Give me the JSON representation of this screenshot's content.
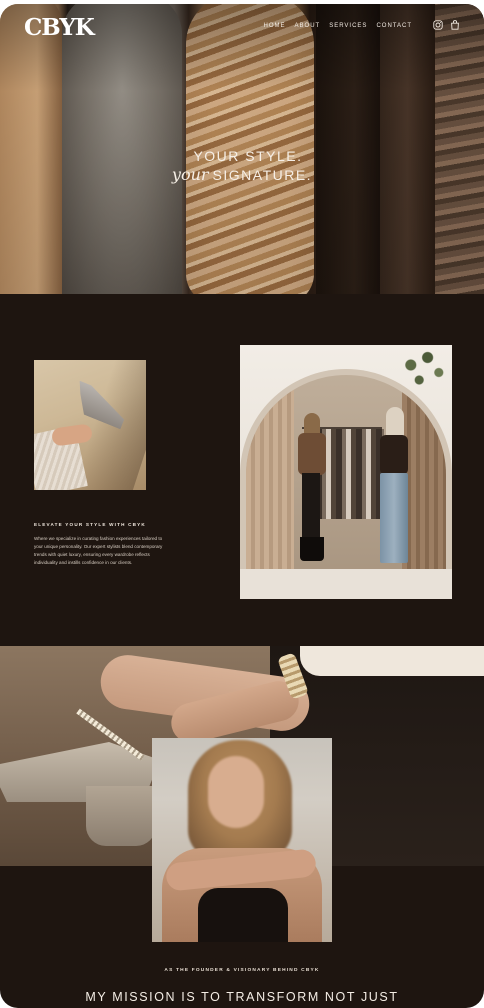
{
  "brand": {
    "logo": "CBYK"
  },
  "nav": {
    "links": [
      "HOME",
      "ABOUT",
      "SERVICES",
      "CONTACT"
    ],
    "icons": [
      "instagram-icon",
      "shopping-bag-icon"
    ]
  },
  "hero": {
    "line1": "YOUR STYLE.",
    "script": "your",
    "line2": "SIGNATURE."
  },
  "intro": {
    "heading": "ELEVATE YOUR STYLE WITH CBYK",
    "body": "Where we specialize in curating fashion experiences tailored to your unique personality. Our expert stylists blend contemporary trends with quiet luxury, ensuring every wardrobe reflects individuality and instills confidence in our clients."
  },
  "founder": {
    "eyebrow": "AS THE FOUNDER & VISIONARY BEHIND CBYK",
    "headline": "MY MISSION IS TO TRANSFORM NOT JUST"
  },
  "colors": {
    "background_dark": "#1e1510",
    "text_light": "#f4ede5"
  }
}
